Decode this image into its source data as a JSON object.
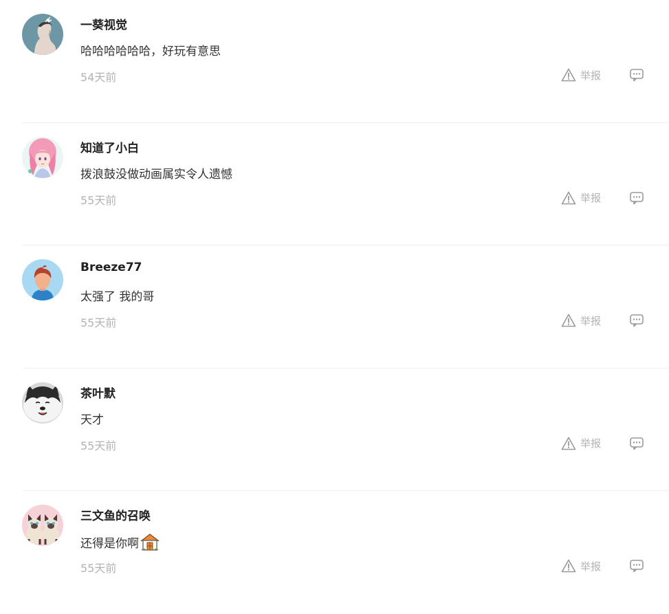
{
  "comments": [
    {
      "username": "一葵视觉",
      "text": "哈哈哈哈哈哈，好玩有意思",
      "time": "54天前",
      "report_label": "举报",
      "avatar_icon": "woman-profile-avatar",
      "emoji": null
    },
    {
      "username": "知道了小白",
      "text": "拨浪鼓没做动画属实令人遗憾",
      "time": "55天前",
      "report_label": "举报",
      "avatar_icon": "anime-girl-avatar",
      "emoji": null
    },
    {
      "username": "Breeze77",
      "text": "太强了 我的哥",
      "time": "55天前",
      "report_label": "举报",
      "avatar_icon": "default-man-avatar",
      "emoji": null
    },
    {
      "username": "茶叶默",
      "text": "天才",
      "time": "55天前",
      "report_label": "举报",
      "avatar_icon": "husky-dog-avatar",
      "emoji": null
    },
    {
      "username": "三文鱼的召唤",
      "text": "还得是你啊",
      "time": "55天前",
      "report_label": "举报",
      "avatar_icon": "siamese-cats-avatar",
      "emoji": "house-emoji"
    }
  ],
  "colors": {
    "text_primary": "#222222",
    "text_body": "#333333",
    "text_muted": "#b3b3b3",
    "divider": "#eeeeee",
    "icon_gray": "#999999"
  }
}
